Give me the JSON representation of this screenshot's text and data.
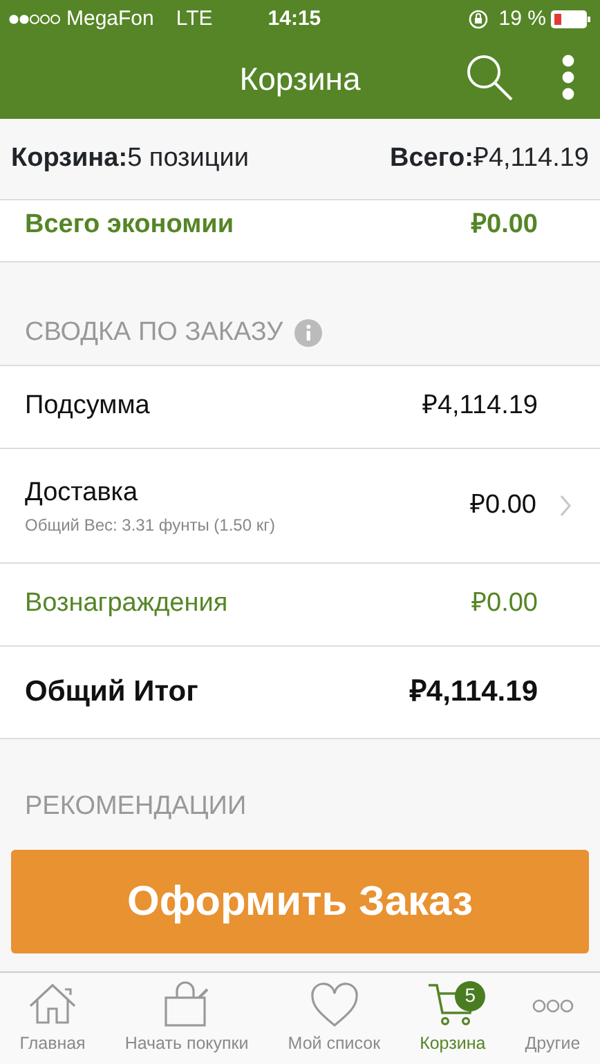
{
  "status_bar": {
    "carrier": "MegaFon",
    "network": "LTE",
    "time": "14:15",
    "battery": "19 %"
  },
  "header": {
    "title": "Корзина"
  },
  "summary_bar": {
    "cart_label": "Корзина:",
    "cart_count": "5 позиции",
    "total_label": "Всего:",
    "total_value": "₽4,114.19"
  },
  "savings": {
    "label": "Всего экономии",
    "value": "₽0.00"
  },
  "order_summary": {
    "heading": "СВОДКА ПО ЗАКАЗУ",
    "rows": [
      {
        "kind": "plain",
        "label": "Подсумма",
        "value": "₽4,114.19"
      },
      {
        "kind": "link",
        "label": "Доставка",
        "note": "Общий Вес: 3.31 фунты (1.50 кг)",
        "value": "₽0.00"
      },
      {
        "kind": "green",
        "label": "Вознаграждения",
        "value": "₽0.00"
      },
      {
        "kind": "total",
        "label": "Общий Итог",
        "value": "₽4,114.19"
      }
    ]
  },
  "recommendations": {
    "heading": "РЕКОМЕНДАЦИИ"
  },
  "checkout_button": "Оформить Заказ",
  "tab_bar": [
    {
      "label": "Главная",
      "selected": false
    },
    {
      "label": "Начать покупки",
      "selected": false
    },
    {
      "label": "Мой список",
      "selected": false
    },
    {
      "label": "Корзина",
      "selected": true,
      "badge": "5"
    },
    {
      "label": "Другие",
      "selected": false
    }
  ]
}
